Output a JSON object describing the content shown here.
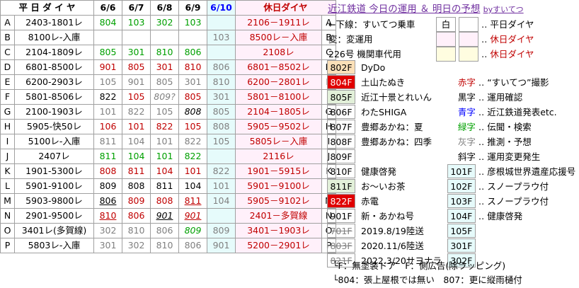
{
  "header": {
    "left": "平 日 ダ イ ヤ",
    "days": [
      "6/6",
      "6/7",
      "6/8",
      "6/9",
      "6/10"
    ],
    "holiday": "休日ダイヤ"
  },
  "rows": [
    {
      "k": "A",
      "d": "2403-1801レ",
      "v": [
        [
          "804",
          "green"
        ],
        [
          "103",
          "green"
        ],
        [
          "302",
          "green"
        ],
        [
          "103",
          "green"
        ],
        [
          "",
          ""
        ]
      ],
      "h": "2106－1911レ"
    },
    {
      "k": "B",
      "d": "8100レ-入庫",
      "v": [
        [
          "",
          ""
        ],
        [
          "",
          ""
        ],
        [
          "",
          ""
        ],
        [
          "",
          ""
        ],
        [
          "103",
          "gray"
        ]
      ],
      "h": "8500レ－入庫"
    },
    {
      "k": "C",
      "d": "2104-1809レ",
      "v": [
        [
          "805",
          "green"
        ],
        [
          "301",
          "green"
        ],
        [
          "810",
          "green"
        ],
        [
          "806",
          "green"
        ],
        [
          "",
          ""
        ]
      ],
      "h": "2108レ"
    },
    {
      "k": "D",
      "d": "6801-8500レ",
      "v": [
        [
          "901",
          "red"
        ],
        [
          "805",
          "red"
        ],
        [
          "301",
          "red"
        ],
        [
          "810",
          "red"
        ],
        [
          "806",
          "gray"
        ]
      ],
      "h": "6801－8502レ"
    },
    {
      "k": "E",
      "d": "6200-2903レ",
      "v": [
        [
          "105",
          "gray"
        ],
        [
          "901",
          "gray"
        ],
        [
          "805",
          "gray"
        ],
        [
          "301",
          "gray"
        ],
        [
          "810",
          "gray"
        ]
      ],
      "h": "6200－2801レ"
    },
    {
      "k": "F",
      "d": "5801-8506レ",
      "v": [
        [
          "822",
          "black"
        ],
        [
          "105",
          "red"
        ],
        [
          "809?",
          "gray ital"
        ],
        [
          "805",
          "red"
        ],
        [
          "301",
          "gray"
        ]
      ],
      "h": "5801－8100レ"
    },
    {
      "k": "G",
      "d": "2100-1903レ",
      "v": [
        [
          "101",
          "gray"
        ],
        [
          "822",
          "gray"
        ],
        [
          "105",
          "gray"
        ],
        [
          "808",
          "black ital"
        ],
        [
          "805",
          "gray"
        ]
      ],
      "h": "2104－1805レ"
    },
    {
      "k": "H",
      "d": "5905-快50レ",
      "v": [
        [
          "106",
          "red"
        ],
        [
          "101",
          "red"
        ],
        [
          "822",
          "red"
        ],
        [
          "105",
          "red"
        ],
        [
          "808",
          "gray"
        ]
      ],
      "h": "5905－9502レ"
    },
    {
      "k": "I",
      "d": "5100レ-入庫",
      "v": [
        [
          "811",
          "gray"
        ],
        [
          "104",
          "gray"
        ],
        [
          "101",
          "gray"
        ],
        [
          "822",
          "gray"
        ],
        [
          "105",
          "gray"
        ]
      ],
      "h": "5805レ－入庫"
    },
    {
      "k": "J",
      "d": "2407レ",
      "v": [
        [
          "811",
          "green"
        ],
        [
          "104",
          "green"
        ],
        [
          "101",
          "green"
        ],
        [
          "822",
          "green"
        ],
        [
          "",
          ""
        ]
      ],
      "h": "2116レ"
    },
    {
      "k": "K",
      "d": "1901-5300レ",
      "v": [
        [
          "808",
          "red"
        ],
        [
          "811",
          "red"
        ],
        [
          "104",
          "red"
        ],
        [
          "101",
          "red"
        ],
        [
          "822",
          "gray"
        ]
      ],
      "h": "1901－5915レ"
    },
    {
      "k": "L",
      "d": "5901-9100レ",
      "v": [
        [
          "809",
          "black"
        ],
        [
          "808",
          "black"
        ],
        [
          "811",
          "black"
        ],
        [
          "104",
          "black"
        ],
        [
          "101",
          "gray"
        ]
      ],
      "h": "5901－9100レ"
    },
    {
      "k": "M",
      "d": "5903-9800レ",
      "v": [
        [
          "806",
          "black uline"
        ],
        [
          "809",
          "red"
        ],
        [
          "808",
          "red"
        ],
        [
          "811",
          "red uline"
        ],
        [
          "104",
          "gray"
        ]
      ],
      "h": "5905－9102レ"
    },
    {
      "k": "N",
      "d": "2901-9500レ",
      "v": [
        [
          "810",
          "red uline"
        ],
        [
          "806",
          "red"
        ],
        [
          "901",
          "black ital uline"
        ],
        [
          "901",
          "red ital uline"
        ],
        [
          "",
          ""
        ]
      ],
      "h": "2401－多賀線"
    },
    {
      "k": "O",
      "d": "3401レ(多賀線)",
      "v": [
        [
          "302",
          "gray"
        ],
        [
          "810",
          "gray"
        ],
        [
          "806",
          "gray"
        ],
        [
          "809",
          "green ital"
        ],
        [
          "809",
          "gray"
        ]
      ],
      "h": "3401－1903レ"
    },
    {
      "k": "P",
      "d": "5803レ-入庫",
      "v": [
        [
          "301",
          "gray"
        ],
        [
          "302",
          "gray"
        ],
        [
          "810",
          "gray"
        ],
        [
          "806",
          "gray"
        ],
        [
          "901",
          "gray"
        ]
      ],
      "h": "5200－2901レ"
    }
  ],
  "title": {
    "main": "近江鉄道 今日の運用 ＆ 明日の予想",
    "by": "byすいてつ"
  },
  "legend": [
    {
      "text": "←下線：すいてつ乗車",
      "sw": "白",
      "sw_bg": "#ffffff",
      "desc": "平日ダイヤ",
      "desc_color": "#000000"
    },
    {
      "text": "変：変運用",
      "sw": "",
      "sw_bg": "#fff0fa",
      "desc": "休日ダイヤ",
      "desc_color": "#c00000"
    },
    {
      "text": "226号 機関車代用",
      "sw": "",
      "sw_bg": "#fffde0",
      "desc": "休日ダイヤ",
      "desc_color": "#c00000"
    }
  ],
  "cars": [
    {
      "n": "802F",
      "cls": "o",
      "name": "DyDo",
      "k": "",
      "kc": "",
      "desc": ""
    },
    {
      "n": "804F",
      "cls": "r",
      "name": "土山たぬき",
      "k": "赤字",
      "kc": "#c00000",
      "desc": "“すいてつ”撮影"
    },
    {
      "n": "805F",
      "cls": "g",
      "name": "近江十景とれいん",
      "k": "黒字",
      "kc": "#000000",
      "desc": "運用確認"
    },
    {
      "n": "806F",
      "cls": "",
      "name": "わたSHIGA",
      "k": "青字",
      "kc": "#0000ff",
      "desc": "近江鉄道発表etc."
    },
    {
      "n": "807F",
      "cls": "",
      "name": "豊郷あかね：夏",
      "k": "緑字",
      "kc": "#00a000",
      "desc": "伝聞・検索"
    },
    {
      "n": "808F",
      "cls": "",
      "name": "豊郷あかね：四季",
      "k": "灰字",
      "kc": "#808080",
      "desc": "推測・予想"
    },
    {
      "n": "809F",
      "cls": "",
      "name": "",
      "k": "斜字",
      "kc": "#000000",
      "desc": "運用変更発生"
    },
    {
      "n": "810F",
      "cls": "",
      "name": "健康啓発",
      "k": "101F",
      "kc": "#000000",
      "desc": "彦根城世界遺産応援号"
    },
    {
      "n": "811F",
      "cls": "g",
      "name": "お～いお茶",
      "k": "102F",
      "kc": "#000000",
      "desc": "スノープラウ付"
    },
    {
      "n": "822F",
      "cls": "r",
      "name": "赤電",
      "k": "103F",
      "kc": "#000000",
      "desc": "スノープラウ付"
    },
    {
      "n": "901F",
      "cls": "",
      "name": "新・あかね号",
      "k": "104F",
      "kc": "#000000",
      "desc": "健康啓発"
    },
    {
      "n": "701F",
      "cls": "strike",
      "name": "2019.8/19陸送",
      "k": "105F",
      "kc": "#000000",
      "desc": ""
    },
    {
      "n": "803F",
      "cls": "strike",
      "name": "2020.11/6陸送",
      "k": "301F",
      "kc": "#000000",
      "desc": ""
    },
    {
      "n": "821F",
      "cls": "strike",
      "name": "2022.3/20サヨナラ",
      "k": "302F",
      "kc": "#000000",
      "desc": ""
    }
  ],
  "footer": [
    "└F：無塗装ドア　F：側広告(除ラッピング)",
    "└804：張上屋根では無い　807：更に縦雨樋付"
  ]
}
